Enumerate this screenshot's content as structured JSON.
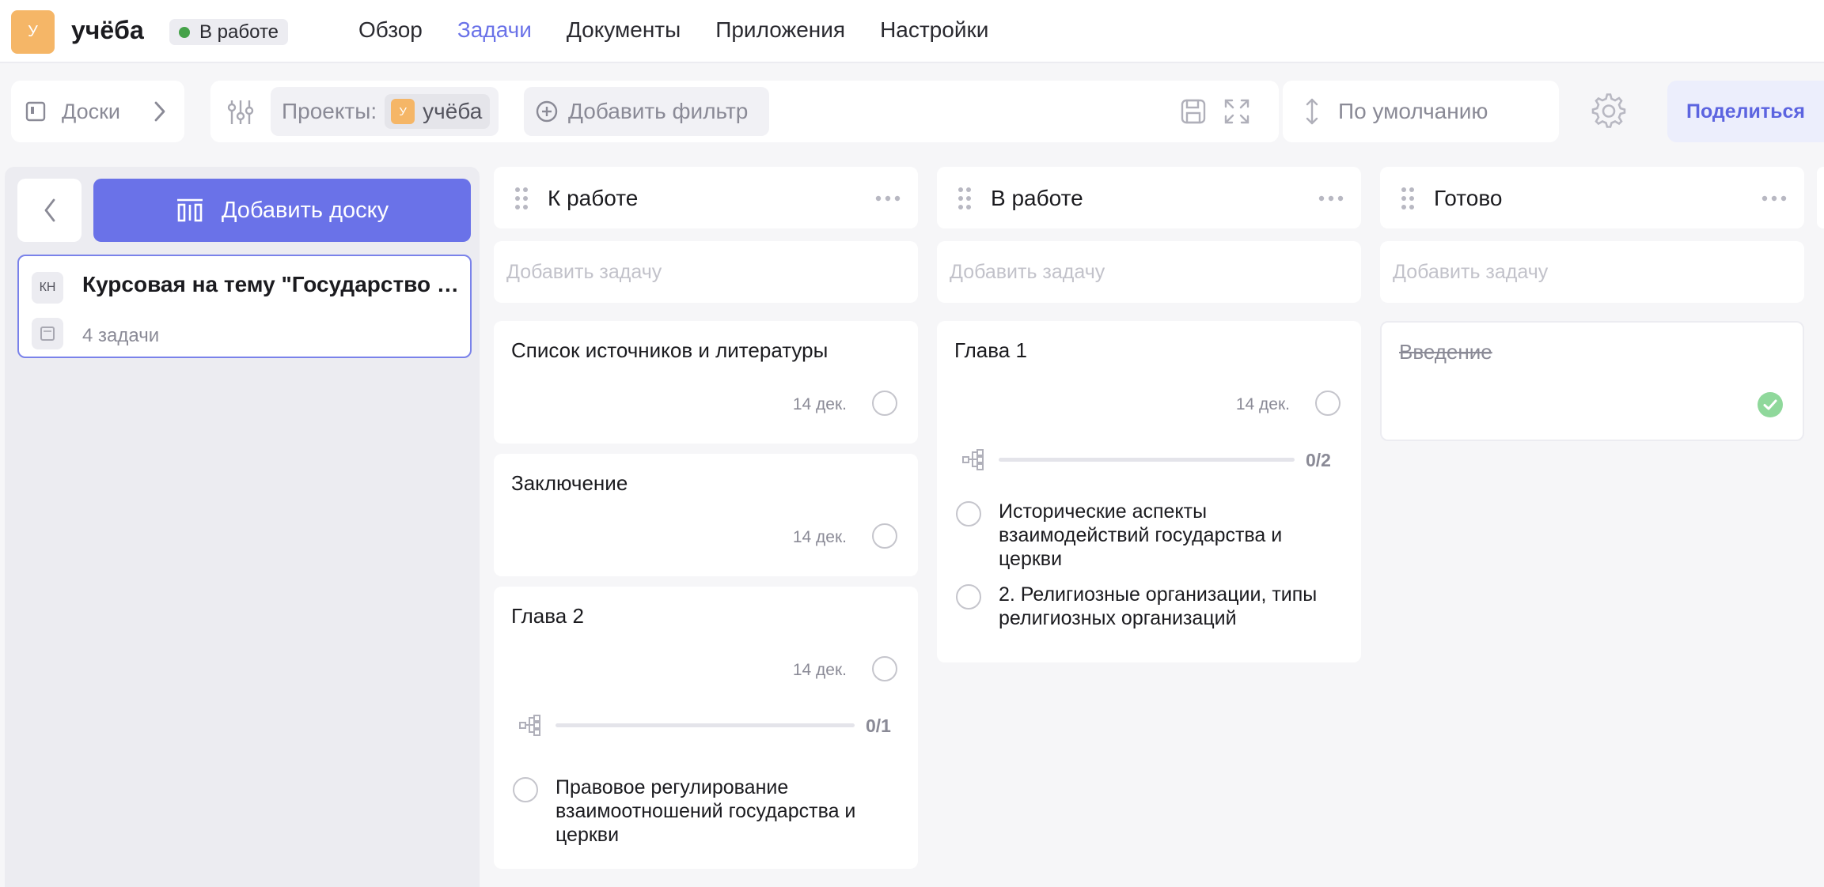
{
  "project": {
    "avatar_letter": "У",
    "title": "учёба",
    "status": "В работе",
    "status_color": "#45a249",
    "avatar_color": "#f5b667"
  },
  "nav": {
    "items": [
      "Обзор",
      "Задачи",
      "Документы",
      "Приложения",
      "Настройки"
    ],
    "active": "Задачи",
    "accent": "#6a72e8"
  },
  "toolbar": {
    "boards_label": "Доски",
    "projects_label": "Проекты:",
    "project_chip": {
      "letter": "У",
      "name": "учёба"
    },
    "add_filter_label": "Добавить фильтр",
    "sort_label": "По умолчанию",
    "share_label": "Поделиться"
  },
  "sidebar": {
    "add_board_label": "Добавить доску",
    "board": {
      "abbr": "КН",
      "title": "Курсовая на тему \"Государство и церковь\"",
      "count": "4 задачи"
    }
  },
  "columns": [
    {
      "title": "К работе",
      "add_task_placeholder": "Добавить задачу",
      "cards": [
        {
          "title": "Список источников и литературы",
          "date": "14 дек."
        },
        {
          "title": "Заключение",
          "date": "14 дек."
        },
        {
          "title": "Глава 2",
          "date": "14 дек.",
          "subtasks_progress": "0/1",
          "subtasks": [
            "Правовое регулирование взаимоотношений государства и церкви"
          ]
        }
      ]
    },
    {
      "title": "В работе",
      "add_task_placeholder": "Добавить задачу",
      "cards": [
        {
          "title": "Глава 1",
          "date": "14 дек.",
          "subtasks_progress": "0/2",
          "subtasks": [
            "Исторические аспекты взаимодействий государства и церкви",
            "2. Религиозные организации, типы религиозных организаций"
          ]
        }
      ]
    },
    {
      "title": "Готово",
      "add_task_placeholder": "Добавить задачу",
      "cards": [
        {
          "title": "Введение",
          "done": true
        }
      ]
    }
  ]
}
